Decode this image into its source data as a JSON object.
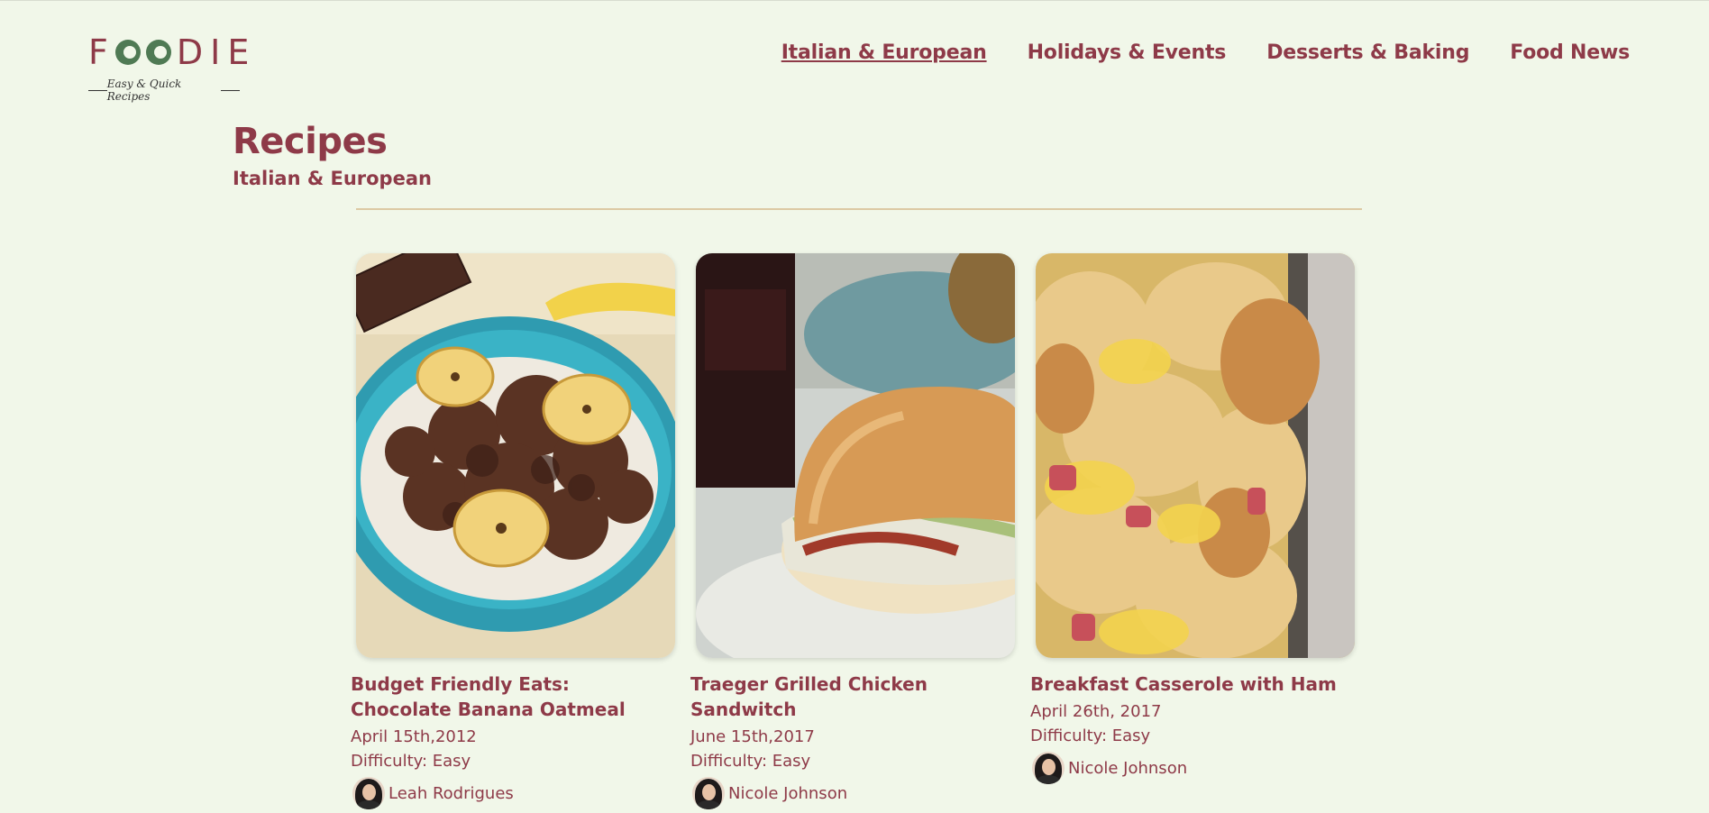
{
  "brand": {
    "name_letters": [
      "F",
      "O",
      "O",
      "D",
      "I",
      "E"
    ],
    "tagline": "Easy & Quick Recipes",
    "colors": {
      "primary": "#8e3a48",
      "accent_green": "#4f7a54",
      "background": "#f1f7e9",
      "divider": "#dcc9a4"
    }
  },
  "nav": {
    "items": [
      {
        "label": "Italian & European",
        "active": true
      },
      {
        "label": "Holidays & Events",
        "active": false
      },
      {
        "label": "Desserts & Baking",
        "active": false
      },
      {
        "label": "Food News",
        "active": false
      }
    ]
  },
  "page": {
    "title": "Recipes",
    "subtitle": "Italian & European"
  },
  "recipes": [
    {
      "title": "Budget Friendly Eats: Chocolate Banana Oatmeal",
      "date": "April 15th,2012",
      "difficulty": "Difficulty: Easy",
      "author": "Leah Rodrigues",
      "image_icon": "chocolate-banana-oatmeal-photo"
    },
    {
      "title": "Traeger Grilled Chicken Sandwitch",
      "date": "June 15th,2017",
      "difficulty": "Difficulty: Easy",
      "author": "Nicole Johnson",
      "image_icon": "chicken-sandwich-photo"
    },
    {
      "title": "Breakfast Casserole with Ham",
      "date": "April 26th, 2017",
      "difficulty": "Difficulty: Easy",
      "author": "Nicole Johnson",
      "image_icon": "breakfast-casserole-photo"
    }
  ]
}
